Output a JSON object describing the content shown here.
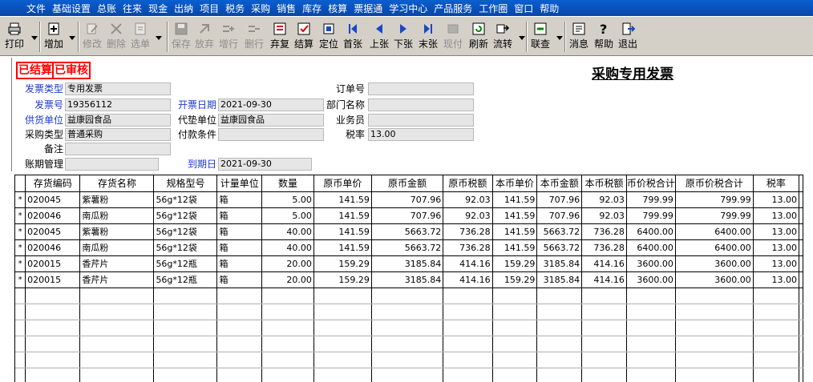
{
  "menu": [
    "文件",
    "基础设置",
    "总账",
    "往来",
    "现金",
    "出纳",
    "项目",
    "税务",
    "采购",
    "销售",
    "库存",
    "核算",
    "票据通",
    "学习中心",
    "产品服务",
    "工作圈",
    "窗口",
    "帮助"
  ],
  "toolbar": [
    {
      "label": "打印",
      "icon": "printer-icon",
      "enabled": true
    },
    {
      "label": "增加",
      "icon": "add-icon",
      "enabled": true
    },
    {
      "label": "修改",
      "icon": "edit-icon",
      "enabled": false
    },
    {
      "label": "删除",
      "icon": "delete-icon",
      "enabled": false
    },
    {
      "label": "选单",
      "icon": "select-icon",
      "enabled": false
    },
    {
      "label": "保存",
      "icon": "save-icon",
      "enabled": false
    },
    {
      "label": "放弃",
      "icon": "discard-icon",
      "enabled": false
    },
    {
      "label": "增行",
      "icon": "add-row-icon",
      "enabled": false
    },
    {
      "label": "删行",
      "icon": "delete-row-icon",
      "enabled": false
    },
    {
      "label": "弃复",
      "icon": "undo-review-icon",
      "enabled": true
    },
    {
      "label": "结算",
      "icon": "settle-icon",
      "enabled": true
    },
    {
      "label": "定位",
      "icon": "locate-icon",
      "enabled": true
    },
    {
      "label": "首张",
      "icon": "first-icon",
      "enabled": true
    },
    {
      "label": "上张",
      "icon": "prev-icon",
      "enabled": true
    },
    {
      "label": "下张",
      "icon": "next-icon",
      "enabled": true
    },
    {
      "label": "末张",
      "icon": "last-icon",
      "enabled": true
    },
    {
      "label": "现付",
      "icon": "cash-pay-icon",
      "enabled": false
    },
    {
      "label": "刷新",
      "icon": "refresh-icon",
      "enabled": true
    },
    {
      "label": "流转",
      "icon": "flow-icon",
      "enabled": true
    },
    {
      "label": "联查",
      "icon": "query-icon",
      "enabled": true
    },
    {
      "label": "消息",
      "icon": "message-icon",
      "enabled": true
    },
    {
      "label": "帮助",
      "icon": "help-icon",
      "enabled": true
    },
    {
      "label": "退出",
      "icon": "exit-icon",
      "enabled": true
    }
  ],
  "form": {
    "stamp1": "已结算",
    "stamp2": "已审核",
    "title": "采购专用发票",
    "invoice_type_label": "发票类型",
    "invoice_type": "专用发票",
    "invoice_no_label": "发票号",
    "invoice_no": "19356112",
    "invoice_date_label": "开票日期",
    "invoice_date": "2021-09-30",
    "supplier_label": "供货单位",
    "supplier": "益康园食品",
    "agent_label": "代垫单位",
    "agent": "益康园食品",
    "purchase_type_label": "采购类型",
    "purchase_type": "普通采购",
    "payment_terms_label": "付款条件",
    "payment_terms": "",
    "remark_label": "备注",
    "remark": "",
    "account_label": "账期管理",
    "account": "",
    "due_date_label": "到期日",
    "due_date": "2021-09-30",
    "order_no_label": "订单号",
    "order_no": "",
    "dept_label": "部门名称",
    "dept": "",
    "salesman_label": "业务员",
    "salesman": "",
    "tax_rate_label": "税率",
    "tax_rate": "13.00"
  },
  "table": {
    "columns": [
      "存货编码",
      "存货名称",
      "规格型号",
      "计量单位",
      "数量",
      "原币单价",
      "原币金额",
      "原币税额",
      "本币单价",
      "本币金额",
      "本币税额",
      "币价税合计",
      "原币价税合计",
      "税率"
    ],
    "rows": [
      [
        "020045",
        "紫薯粉",
        "56g*12袋",
        "箱",
        "5.00",
        "141.59",
        "707.96",
        "92.03",
        "141.59",
        "707.96",
        "92.03",
        "799.99",
        "799.99",
        "13.00"
      ],
      [
        "020046",
        "南瓜粉",
        "56g*12袋",
        "箱",
        "5.00",
        "141.59",
        "707.96",
        "92.03",
        "141.59",
        "707.96",
        "92.03",
        "799.99",
        "799.99",
        "13.00"
      ],
      [
        "020045",
        "紫薯粉",
        "56g*12袋",
        "箱",
        "40.00",
        "141.59",
        "5663.72",
        "736.28",
        "141.59",
        "5663.72",
        "736.28",
        "6400.00",
        "6400.00",
        "13.00"
      ],
      [
        "020046",
        "南瓜粉",
        "56g*12袋",
        "箱",
        "40.00",
        "141.59",
        "5663.72",
        "736.28",
        "141.59",
        "5663.72",
        "736.28",
        "6400.00",
        "6400.00",
        "13.00"
      ],
      [
        "020015",
        "香芹片",
        "56g*12瓶",
        "箱",
        "20.00",
        "159.29",
        "3185.84",
        "414.16",
        "159.29",
        "3185.84",
        "414.16",
        "3600.00",
        "3600.00",
        "13.00"
      ],
      [
        "020015",
        "香芹片",
        "56g*12瓶",
        "箱",
        "20.00",
        "159.29",
        "3185.84",
        "414.16",
        "159.29",
        "3185.84",
        "414.16",
        "3600.00",
        "3600.00",
        "13.00"
      ]
    ],
    "row_marker": "*"
  }
}
